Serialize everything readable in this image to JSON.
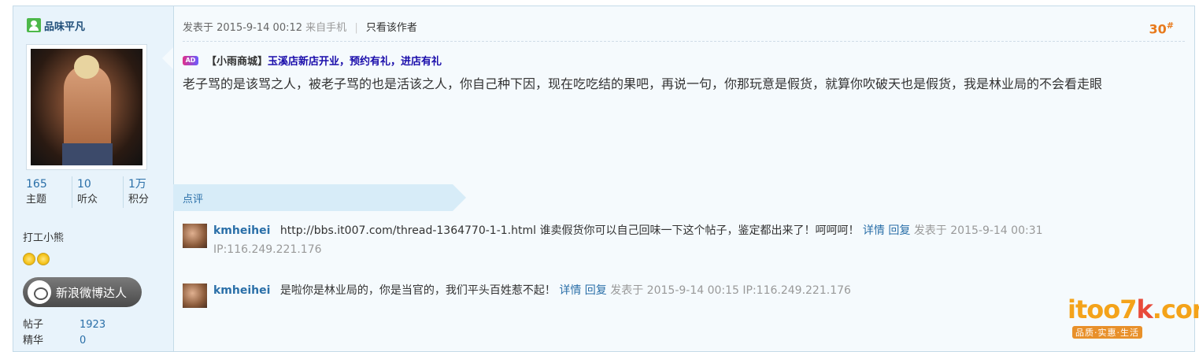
{
  "user": {
    "name": "品味平凡",
    "stats": [
      {
        "num": "165",
        "label": "主题"
      },
      {
        "num": "10",
        "label": "听众"
      },
      {
        "num": "1万",
        "label": "积分"
      }
    ],
    "group": "打工小熊",
    "weibo_label": "新浪微博达人",
    "info": [
      {
        "k": "帖子",
        "v": "1923"
      },
      {
        "k": "精华",
        "v": "0"
      }
    ]
  },
  "post": {
    "meta_prefix": "发表于 2015-9-14 00:12",
    "meta_from": "来自手机",
    "meta_sep": "|",
    "only_author": "只看该作者",
    "floor": "30",
    "floor_mark": "#",
    "ad_badge": "AD",
    "ad_prefix": "【小雨商城】",
    "ad_link": "玉溪店新店开业，预约有礼，进店有礼",
    "content": "老子骂的是该骂之人，被老子骂的也是活该之人，你自己种下因，现在吃吃结的果吧，再说一句，你那玩意是假货，就算你吹破天也是假货，我是林业局的不会看走眼"
  },
  "comments_section": {
    "title": "点评",
    "items": [
      {
        "user": "kmheihei",
        "text": "http://bbs.it007.com/thread-1364770-1-1.html 谁卖假货你可以自己回味一下这个帖子，鉴定都出来了！呵呵呵！",
        "detail": "详情",
        "reply": "回复",
        "time": "发表于 2015-9-14 00:31 IP:116.249.221.176"
      },
      {
        "user": "kmheihei",
        "text": "是啦你是林业局的，你是当官的，我们平头百姓惹不起！",
        "detail": "详情",
        "reply": "回复",
        "time": "发表于 2015-9-14 00:15 IP:116.249.221.176"
      }
    ]
  },
  "watermark": {
    "logo_main": "itoo7",
    "logo_k": "k",
    "logo_tld": ".com",
    "slogan": "品质·实惠·生活"
  }
}
